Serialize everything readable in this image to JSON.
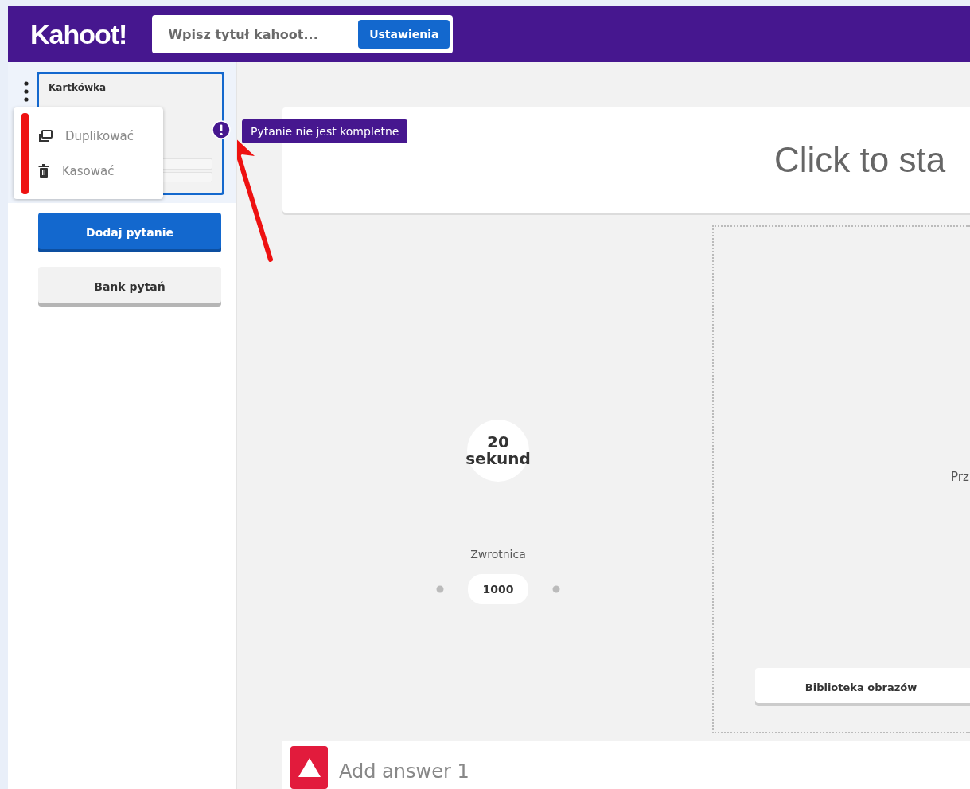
{
  "header": {
    "logo": "Kahoot!",
    "title_field": {
      "placeholder": "Wpisz tytuł kahoot..."
    },
    "settings_button": "Ustawienia"
  },
  "sidebar": {
    "slides": [
      {
        "title": "Kartkówka",
        "selected": true,
        "incomplete": true
      }
    ],
    "context_menu": [
      {
        "label": "Duplikować",
        "kind": "duplicate"
      },
      {
        "label": "Kasować",
        "kind": "delete"
      }
    ],
    "tooltip": "Pytanie nie jest kompletne",
    "add_button": "Dodaj pytanie",
    "bank_button": "Bank pytań"
  },
  "editor": {
    "question": {
      "placeholder": "Click to sta"
    },
    "timer": {
      "value": "20",
      "unit": "sekund"
    },
    "points": {
      "label": "Zwrotnica",
      "value": "1000"
    },
    "media": {
      "hint": "Prz",
      "library_button": "Biblioteka obrazów"
    },
    "answers": [
      {
        "placeholder": "Add answer 1",
        "kind": "triangle",
        "color": "#e21b3c"
      }
    ]
  }
}
